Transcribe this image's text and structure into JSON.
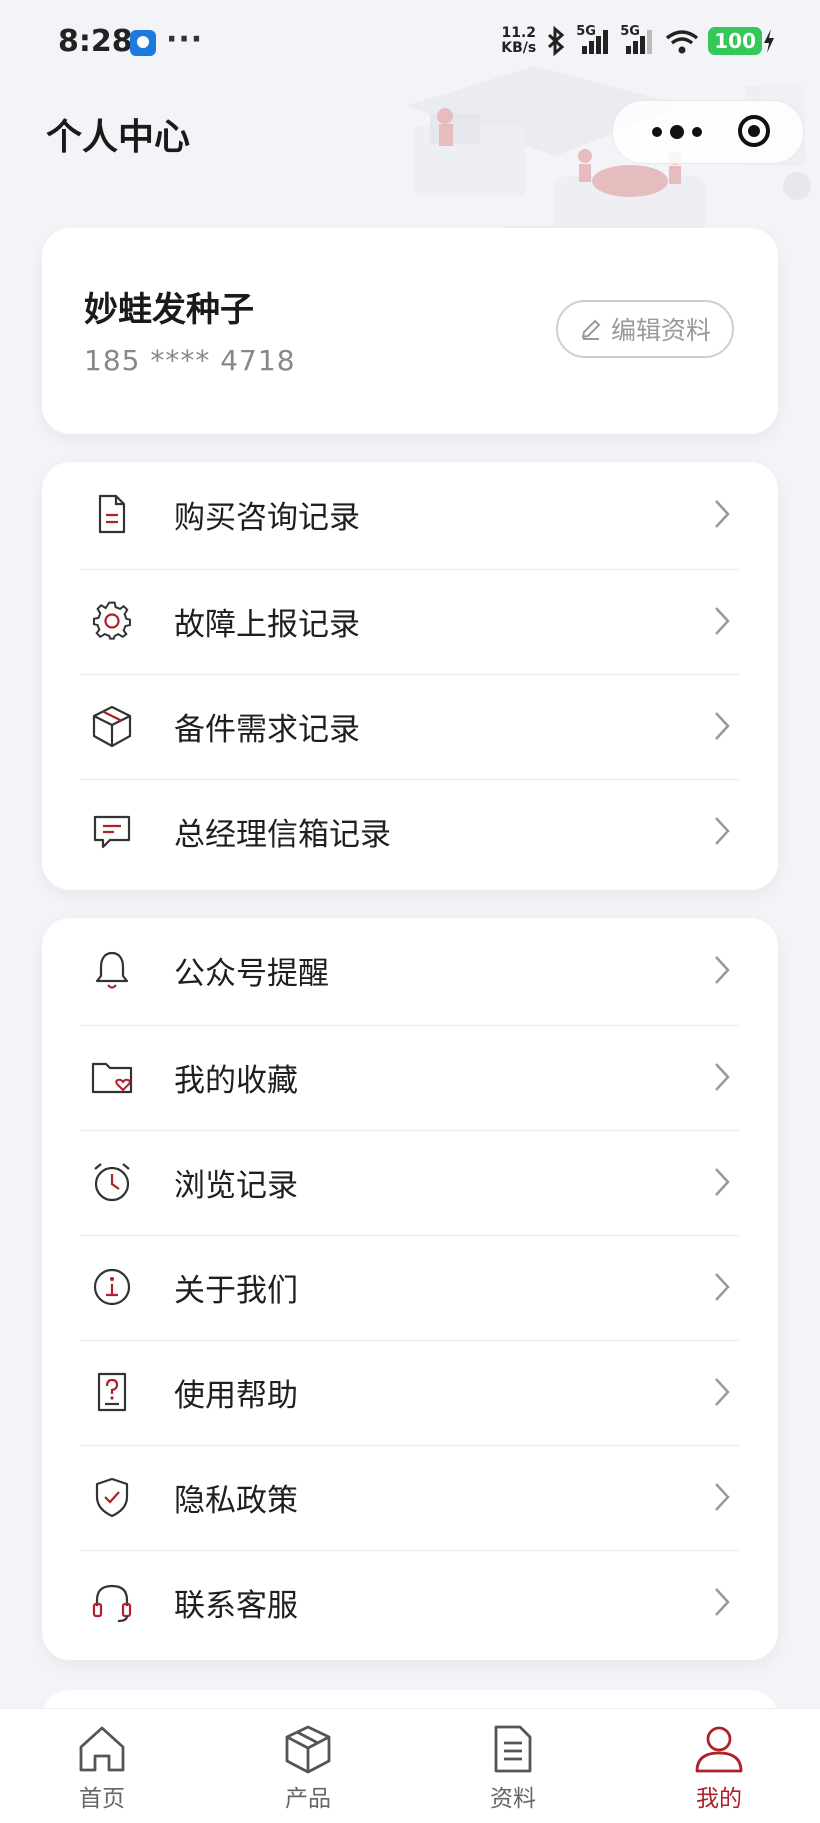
{
  "status_bar": {
    "time": "8:28",
    "dots": "···",
    "speed": "11.2",
    "speed_unit": "KB/s",
    "net1": "5G",
    "net2": "5G",
    "battery": "100"
  },
  "header": {
    "title": "个人中心"
  },
  "profile": {
    "name": "妙蛙发种子",
    "phone": "185 **** 4718",
    "edit_label": "编辑资料"
  },
  "menu_group_1": [
    {
      "label": "购买咨询记录",
      "icon": "document-icon"
    },
    {
      "label": "故障上报记录",
      "icon": "gear-icon"
    },
    {
      "label": "备件需求记录",
      "icon": "box-icon"
    },
    {
      "label": "总经理信箱记录",
      "icon": "message-icon"
    }
  ],
  "menu_group_2": [
    {
      "label": "公众号提醒",
      "icon": "bell-icon"
    },
    {
      "label": "我的收藏",
      "icon": "folder-heart-icon"
    },
    {
      "label": "浏览记录",
      "icon": "alarm-clock-icon"
    },
    {
      "label": "关于我们",
      "icon": "info-icon"
    },
    {
      "label": "使用帮助",
      "icon": "help-doc-icon"
    },
    {
      "label": "隐私政策",
      "icon": "shield-check-icon"
    },
    {
      "label": "联系客服",
      "icon": "headset-icon"
    }
  ],
  "tabs": [
    {
      "label": "首页",
      "icon": "home-icon"
    },
    {
      "label": "产品",
      "icon": "box-icon"
    },
    {
      "label": "资料",
      "icon": "document-icon"
    },
    {
      "label": "我的",
      "icon": "user-icon",
      "active": true
    }
  ],
  "colors": {
    "accent": "#b0202a",
    "background": "#f3f4f8",
    "card": "#ffffff"
  }
}
